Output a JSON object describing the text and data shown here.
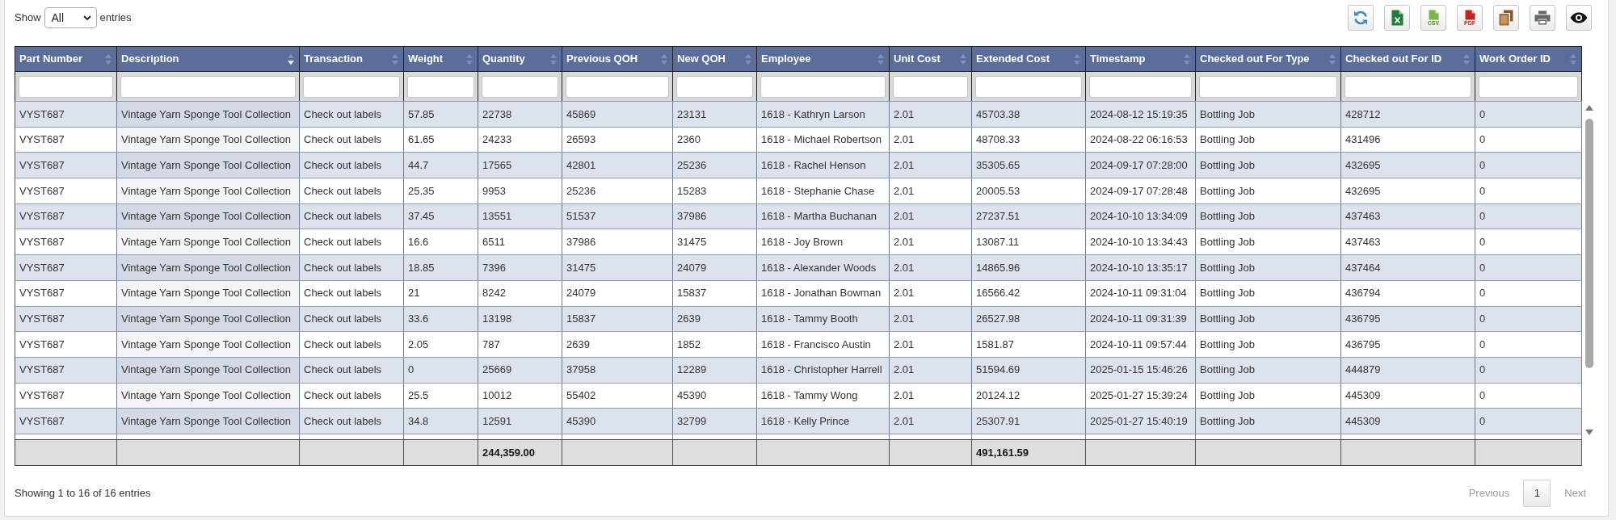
{
  "length_menu": {
    "label": "Show",
    "value": "All",
    "suffix": "entries"
  },
  "toolbar": [
    {
      "kind": "refresh"
    },
    {
      "kind": "excel"
    },
    {
      "kind": "csv",
      "label": "CSV"
    },
    {
      "kind": "pdf",
      "label": "PDF"
    },
    {
      "kind": "copy"
    },
    {
      "kind": "print"
    },
    {
      "kind": "columns"
    }
  ],
  "table": {
    "columns": [
      {
        "label": "Part Number",
        "sorted_descending": false
      },
      {
        "label": "Description",
        "sorted_descending": true
      },
      {
        "label": "Transaction",
        "sorted_descending": false
      },
      {
        "label": "Weight",
        "sorted_descending": false
      },
      {
        "label": "Quantity",
        "sorted_descending": false,
        "total": "244,359.00"
      },
      {
        "label": "Previous QOH",
        "sorted_descending": false
      },
      {
        "label": "New QOH",
        "sorted_descending": false
      },
      {
        "label": "Employee",
        "sorted_descending": false
      },
      {
        "label": "Unit Cost",
        "sorted_descending": false
      },
      {
        "label": "Extended Cost",
        "sorted_descending": false,
        "total": "491,161.59"
      },
      {
        "label": "Timestamp",
        "sorted_descending": false
      },
      {
        "label": "Checked out For Type",
        "sorted_descending": false
      },
      {
        "label": "Checked out For ID",
        "sorted_descending": false
      },
      {
        "label": "Work Order ID",
        "sorted_descending": false
      }
    ],
    "rows": [
      [
        "VYST687",
        "Vintage Yarn Sponge Tool Collection",
        "Check out labels",
        "57.85",
        "22738",
        "45869",
        "23131",
        "1618 - Kathryn Larson",
        "2.01",
        "45703.38",
        "2024-08-12 15:19:35",
        "Bottling Job",
        "428712",
        "0"
      ],
      [
        "VYST687",
        "Vintage Yarn Sponge Tool Collection",
        "Check out labels",
        "61.65",
        "24233",
        "26593",
        "2360",
        "1618 - Michael Robertson",
        "2.01",
        "48708.33",
        "2024-08-22 06:16:53",
        "Bottling Job",
        "431496",
        "0"
      ],
      [
        "VYST687",
        "Vintage Yarn Sponge Tool Collection",
        "Check out labels",
        "44.7",
        "17565",
        "42801",
        "25236",
        "1618 - Rachel Henson",
        "2.01",
        "35305.65",
        "2024-09-17 07:28:00",
        "Bottling Job",
        "432695",
        "0"
      ],
      [
        "VYST687",
        "Vintage Yarn Sponge Tool Collection",
        "Check out labels",
        "25.35",
        "9953",
        "25236",
        "15283",
        "1618 - Stephanie Chase",
        "2.01",
        "20005.53",
        "2024-09-17 07:28:48",
        "Bottling Job",
        "432695",
        "0"
      ],
      [
        "VYST687",
        "Vintage Yarn Sponge Tool Collection",
        "Check out labels",
        "37.45",
        "13551",
        "51537",
        "37986",
        "1618 - Martha Buchanan",
        "2.01",
        "27237.51",
        "2024-10-10 13:34:09",
        "Bottling Job",
        "437463",
        "0"
      ],
      [
        "VYST687",
        "Vintage Yarn Sponge Tool Collection",
        "Check out labels",
        "16.6",
        "6511",
        "37986",
        "31475",
        "1618 - Joy Brown",
        "2.01",
        "13087.11",
        "2024-10-10 13:34:43",
        "Bottling Job",
        "437463",
        "0"
      ],
      [
        "VYST687",
        "Vintage Yarn Sponge Tool Collection",
        "Check out labels",
        "18.85",
        "7396",
        "31475",
        "24079",
        "1618 - Alexander Woods",
        "2.01",
        "14865.96",
        "2024-10-10 13:35:17",
        "Bottling Job",
        "437464",
        "0"
      ],
      [
        "VYST687",
        "Vintage Yarn Sponge Tool Collection",
        "Check out labels",
        "21",
        "8242",
        "24079",
        "15837",
        "1618 - Jonathan Bowman",
        "2.01",
        "16566.42",
        "2024-10-11 09:31:04",
        "Bottling Job",
        "436794",
        "0"
      ],
      [
        "VYST687",
        "Vintage Yarn Sponge Tool Collection",
        "Check out labels",
        "33.6",
        "13198",
        "15837",
        "2639",
        "1618 - Tammy Booth",
        "2.01",
        "26527.98",
        "2024-10-11 09:31:39",
        "Bottling Job",
        "436795",
        "0"
      ],
      [
        "VYST687",
        "Vintage Yarn Sponge Tool Collection",
        "Check out labels",
        "2.05",
        "787",
        "2639",
        "1852",
        "1618 - Francisco Austin",
        "2.01",
        "1581.87",
        "2024-10-11 09:57:44",
        "Bottling Job",
        "436795",
        "0"
      ],
      [
        "VYST687",
        "Vintage Yarn Sponge Tool Collection",
        "Check out labels",
        "0",
        "25669",
        "37958",
        "12289",
        "1618 - Christopher Harrell",
        "2.01",
        "51594.69",
        "2025-01-15 15:46:26",
        "Bottling Job",
        "444879",
        "0"
      ],
      [
        "VYST687",
        "Vintage Yarn Sponge Tool Collection",
        "Check out labels",
        "25.5",
        "10012",
        "55402",
        "45390",
        "1618 - Tammy Wong",
        "2.01",
        "20124.12",
        "2025-01-27 15:39:24",
        "Bottling Job",
        "445309",
        "0"
      ],
      [
        "VYST687",
        "Vintage Yarn Sponge Tool Collection",
        "Check out labels",
        "34.8",
        "12591",
        "45390",
        "32799",
        "1618 - Kelly Prince",
        "2.01",
        "25307.91",
        "2025-01-27 15:40:19",
        "Bottling Job",
        "445309",
        "0"
      ]
    ]
  },
  "info": "Showing 1 to 16 of 16 entries",
  "pagination": {
    "previous": {
      "label": "Previous",
      "disabled": true
    },
    "pages": [
      {
        "label": "1",
        "selected": true
      }
    ],
    "next": {
      "label": "Next",
      "disabled": true
    }
  }
}
